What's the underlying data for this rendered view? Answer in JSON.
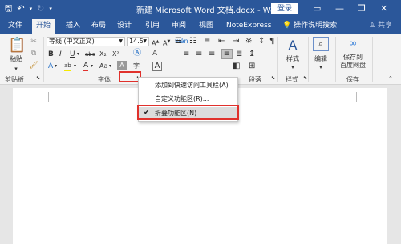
{
  "titlebar": {
    "title": "新建 Microsoft Word 文档.docx - Word",
    "login": "登录",
    "icons": [
      "save-icon",
      "undo-icon",
      "redo-icon",
      "customize-qat-icon",
      "ribbon-display-icon",
      "minimize-icon",
      "restore-icon",
      "close-icon"
    ]
  },
  "tabs": {
    "items": [
      "文件",
      "开始",
      "插入",
      "布局",
      "设计",
      "引用",
      "审阅",
      "视图",
      "NoteExpress"
    ],
    "active": "开始",
    "tellme": "操作说明搜索",
    "share": "共享"
  },
  "ribbon": {
    "clipboard": {
      "paste": "粘贴",
      "label": "剪贴板"
    },
    "font": {
      "font_name": "等线 (中文正文)",
      "font_size": "14.5",
      "label": "字体",
      "row2": [
        "B",
        "I",
        "U",
        "abc",
        "X₂",
        "X²"
      ],
      "row3": [
        "A",
        "ab",
        "A",
        "Aa",
        "A",
        "A",
        "A"
      ]
    },
    "paragraph": {
      "label": "段落"
    },
    "styles": {
      "btn": "样式",
      "label": "样式"
    },
    "editing": {
      "btn": "编辑"
    },
    "save": {
      "btn1": "保存到",
      "btn2": "百度网盘",
      "label": "保存"
    }
  },
  "context_menu": {
    "items": [
      {
        "label": "添加到快速访问工具栏(A)",
        "checked": false
      },
      {
        "label": "自定义功能区(R)...",
        "checked": false
      },
      {
        "label": "折叠功能区(N)",
        "checked": true
      }
    ],
    "check_glyph": "✔"
  },
  "colors": {
    "brand": "#2b579a",
    "highlight": "#e0312c",
    "ribbon_bg": "#f3f3f3"
  }
}
